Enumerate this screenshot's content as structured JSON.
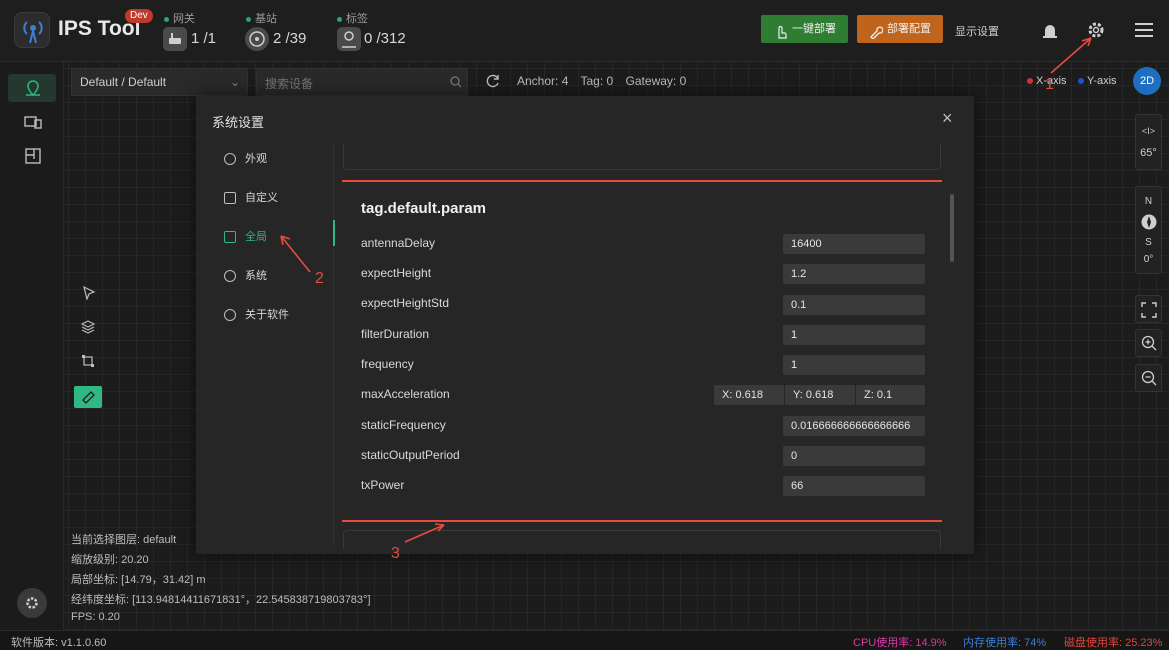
{
  "header": {
    "app_title": "IPS Tool",
    "dev_badge": "Dev",
    "stats": [
      {
        "label": "网关",
        "value": "1 /1"
      },
      {
        "label": "基站",
        "value": "2 /39"
      },
      {
        "label": "标签",
        "value": "0 /312"
      }
    ],
    "deploy_button": "一键部署",
    "deploy_config_button": "部署配置",
    "display_settings": "显示设置"
  },
  "toolbar": {
    "project_select": "Default / Default",
    "search_placeholder": "搜索设备",
    "counts": {
      "anchor": "Anchor: 4",
      "tag": "Tag: 0",
      "gateway": "Gateway: 0"
    },
    "x_axis": "X-axis",
    "y_axis": "Y-axis",
    "view_mode": "2D"
  },
  "right_panel": {
    "tilt_symbol": "<I>",
    "tilt_value": "65°",
    "compass_n": "N",
    "compass_s": "S",
    "compass_value": "0°"
  },
  "info": {
    "layer": "当前选择图层:   default",
    "zoom": "缩放级别:   20.20",
    "local": "局部坐标:   [14.79，31.42] m",
    "geo": "经纬度坐标:   [113.94814411671831°，22.545838719803783°]",
    "fps": "FPS:   0.20"
  },
  "status": {
    "version": "软件版本: v1.1.0.60",
    "cpu": "CPU使用率: 14.9%",
    "mem": "内存使用率: 74%",
    "disk": "磁盘使用率: 25.23%"
  },
  "colors": {
    "cpu": "#d63aa6",
    "mem": "#3b7fd9",
    "disk": "#e0463a",
    "accent": "#2fb883"
  },
  "modal": {
    "title": "系统设置",
    "nav": [
      {
        "label": "外观",
        "icon": "palette-icon"
      },
      {
        "label": "自定义",
        "icon": "edit-icon"
      },
      {
        "label": "全局",
        "icon": "sliders-icon"
      },
      {
        "label": "系统",
        "icon": "gear-icon"
      },
      {
        "label": "关于软件",
        "icon": "info-icon"
      }
    ],
    "section_title": "tag.default.param",
    "params": [
      {
        "label": "antennaDelay",
        "value": "16400"
      },
      {
        "label": "expectHeight",
        "value": "1.2"
      },
      {
        "label": "expectHeightStd",
        "value": "0.1"
      },
      {
        "label": "filterDuration",
        "value": "1"
      },
      {
        "label": "frequency",
        "value": "1"
      },
      {
        "label": "maxAcceleration",
        "x": "X: 0.618",
        "y": "Y: 0.618",
        "z": "Z: 0.1"
      },
      {
        "label": "staticFrequency",
        "value": "0.016666666666666666"
      },
      {
        "label": "staticOutputPeriod",
        "value": "0"
      },
      {
        "label": "txPower",
        "value": "66"
      }
    ]
  },
  "annotations": [
    "1",
    "2",
    "3"
  ]
}
